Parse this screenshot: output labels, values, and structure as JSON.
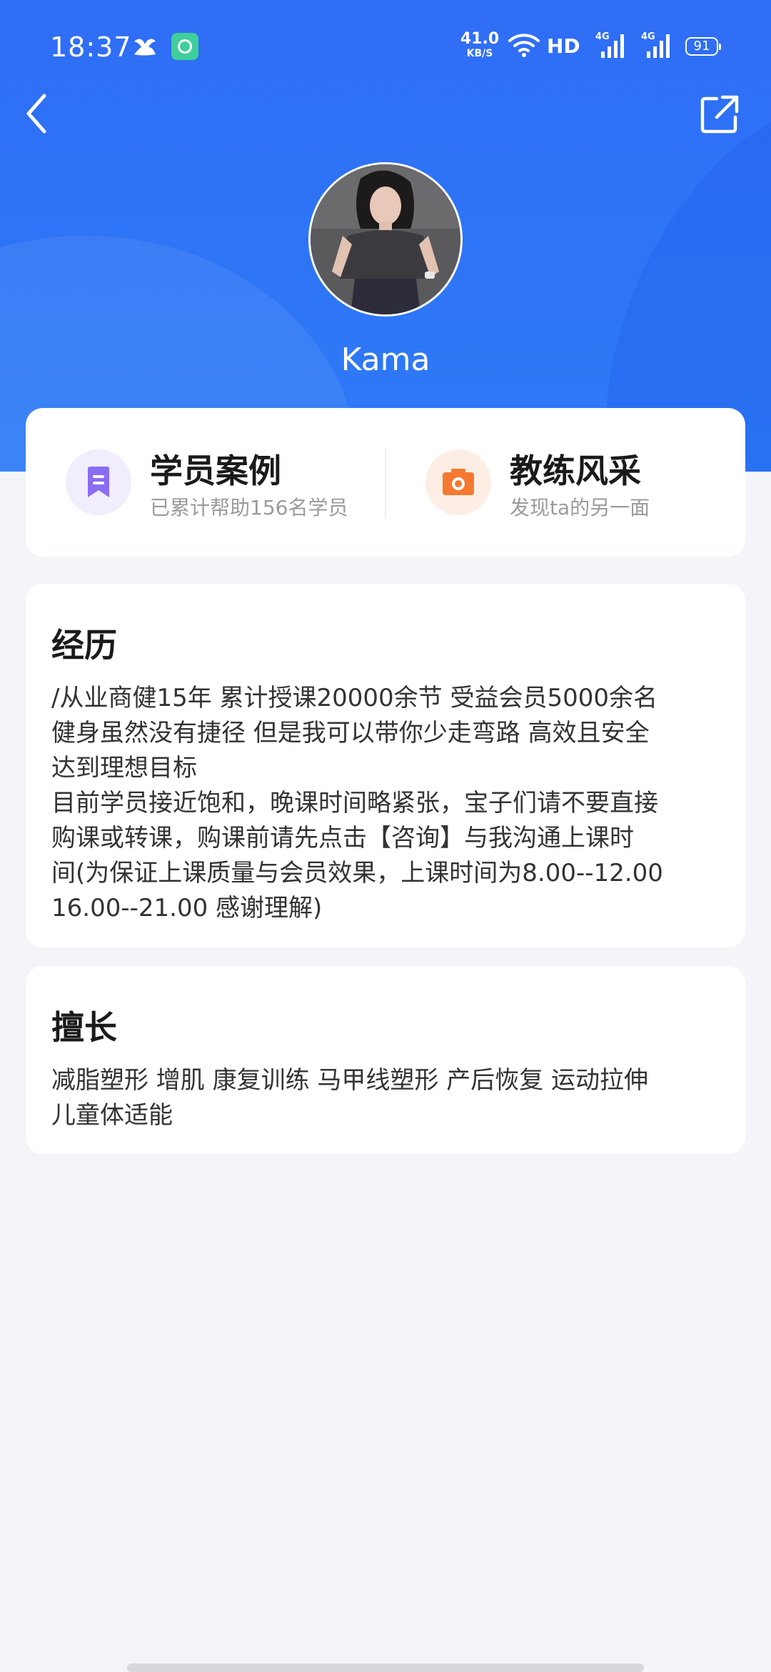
{
  "status_bar": {
    "time": "18:37",
    "net_speed_value": "41.0",
    "net_speed_unit": "KB/S",
    "hd_label": "HD",
    "signal1_label": "4G",
    "signal2_label": "4G",
    "battery": "91"
  },
  "nav": {
    "back_icon": "chevron-left-icon",
    "share_icon": "share-external-icon"
  },
  "profile": {
    "name": "Kama"
  },
  "entries": [
    {
      "title": "学员案例",
      "subtitle": "已累计帮助156名学员",
      "icon": "bookmark-icon",
      "icon_color": "#8a6cf2",
      "icon_bg": "#f1edfd"
    },
    {
      "title": "教练风采",
      "subtitle": "发现ta的另一面",
      "icon": "camera-icon",
      "icon_color": "#f5792f",
      "icon_bg": "#fdeee5"
    }
  ],
  "experience": {
    "title": "经历",
    "lines": [
      "/从业商健15年 累计授课20000余节 受益会员5000余名",
      "健身虽然没有捷径 但是我可以带你少走弯路 高效且安全",
      "达到理想目标",
      "目前学员接近饱和，晚课时间略紧张，宝子们请不要直接",
      "购课或转课，购课前请先点击【咨询】与我沟通上课时",
      "间(为保证上课质量与会员效果，上课时间为8.00--12.00",
      "16.00--21.00 感谢理解)"
    ]
  },
  "specialty": {
    "title": "擅长",
    "lines": [
      "减脂塑形 增肌 康复训练 马甲线塑形 产后恢复 运动拉伸",
      "儿童体适能"
    ]
  },
  "colors": {
    "header_blue": "#2f6df5",
    "page_bg": "#f4f5f9"
  }
}
